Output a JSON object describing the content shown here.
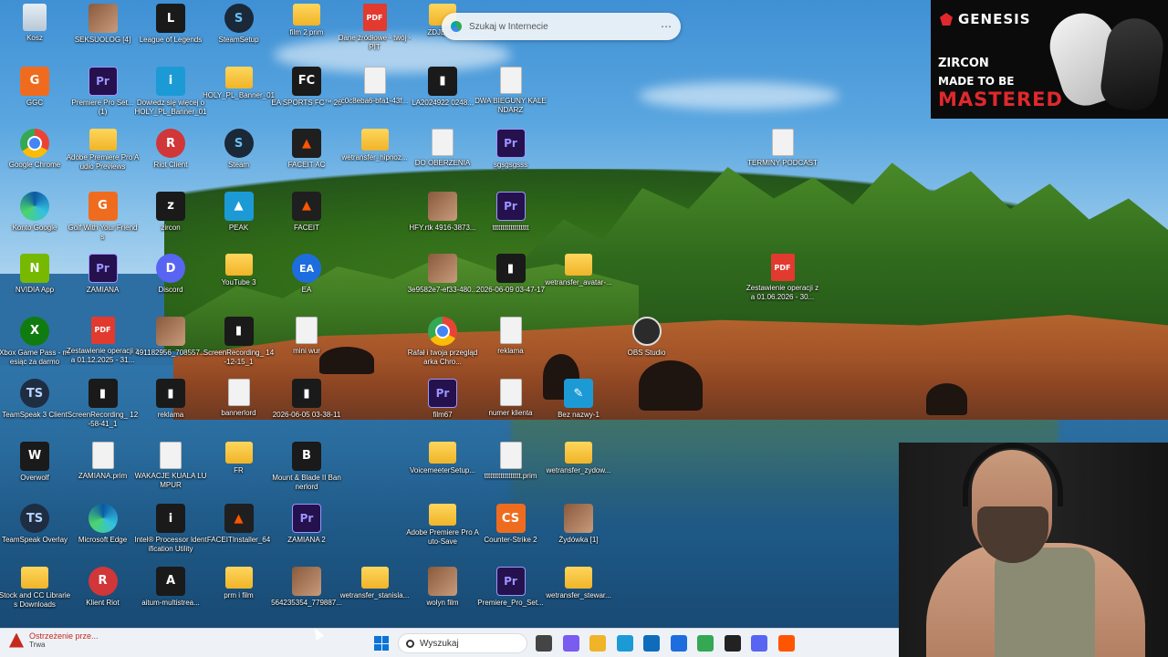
{
  "desktop": {
    "icons": [
      {
        "label": "Kosz",
        "type": "ic-recycle",
        "glyph": "",
        "col": 0,
        "row": 0
      },
      {
        "label": "SEKSUOLOG [4]",
        "type": "ic-thumb",
        "glyph": "",
        "col": 1,
        "row": 0
      },
      {
        "label": "League of Legends",
        "type": "ic-dark",
        "glyph": "L",
        "col": 2,
        "row": 0
      },
      {
        "label": "SteamSetup",
        "type": "ic-steam",
        "glyph": "S",
        "col": 3,
        "row": 0
      },
      {
        "label": "film 2 prim",
        "type": "ic-folder",
        "glyph": "",
        "col": 4,
        "row": 0
      },
      {
        "label": "Dane źródłowe - twój - PIT",
        "type": "ic-pdf",
        "glyph": "PDF",
        "col": 5,
        "row": 0
      },
      {
        "label": "ZDJĘCIA",
        "type": "ic-folder",
        "glyph": "",
        "col": 6,
        "row": 0
      },
      {
        "label": "GGC",
        "type": "ic-orange",
        "glyph": "G",
        "col": 0,
        "row": 1
      },
      {
        "label": "Premiere Pro Set... (1)",
        "type": "ic-pr",
        "glyph": "Pr",
        "col": 1,
        "row": 1
      },
      {
        "label": "Dowiedz się więcej o HOLY_PL_Banner_01 tym zdjęciu",
        "type": "ic-blue",
        "glyph": "i",
        "col": 2,
        "row": 1
      },
      {
        "label": "HOLY_PL_Banner_01",
        "type": "ic-folder",
        "glyph": "",
        "col": 3,
        "row": 1
      },
      {
        "label": "EA SPORTS FC™ 26",
        "type": "ic-dark",
        "glyph": "FC",
        "col": 4,
        "row": 1
      },
      {
        "label": "c0c8eba6-bfa1-43f...",
        "type": "ic-file",
        "glyph": "",
        "col": 5,
        "row": 1
      },
      {
        "label": "LA2024922 0248...",
        "type": "ic-dark",
        "glyph": "▮",
        "col": 6,
        "row": 1
      },
      {
        "label": "DWA BIEGUNY KALENDARZ",
        "type": "ic-file",
        "glyph": "",
        "col": 7,
        "row": 1
      },
      {
        "label": "Google Chrome",
        "type": "ic-chrome",
        "glyph": "",
        "col": 0,
        "row": 2
      },
      {
        "label": "Adobe Premiere Pro Audio Previews",
        "type": "ic-folder",
        "glyph": "",
        "col": 1,
        "row": 2
      },
      {
        "label": "Riot Client",
        "type": "ic-riot",
        "glyph": "R",
        "col": 2,
        "row": 2
      },
      {
        "label": "Steam",
        "type": "ic-steam",
        "glyph": "S",
        "col": 3,
        "row": 2
      },
      {
        "label": "FACEIT AC",
        "type": "ic-faceit",
        "glyph": "▲",
        "col": 4,
        "row": 2
      },
      {
        "label": "wetransfer_hipnoz...",
        "type": "ic-folder",
        "glyph": "",
        "col": 5,
        "row": 2
      },
      {
        "label": "DO OBERZENIA",
        "type": "ic-file",
        "glyph": "",
        "col": 6,
        "row": 2
      },
      {
        "label": "sgsgsgsss",
        "type": "ic-pr",
        "glyph": "Pr",
        "col": 7,
        "row": 2
      },
      {
        "label": "TERMINY PODCAST",
        "type": "ic-file",
        "glyph": "",
        "col": 11,
        "row": 2
      },
      {
        "label": "Konto Google",
        "type": "ic-edge",
        "glyph": "",
        "col": 0,
        "row": 3
      },
      {
        "label": "Golf With Your Friends",
        "type": "ic-orange",
        "glyph": "G",
        "col": 1,
        "row": 3
      },
      {
        "label": "zircon",
        "type": "ic-dark",
        "glyph": "z",
        "col": 2,
        "row": 3
      },
      {
        "label": "PEAK",
        "type": "ic-blue",
        "glyph": "▲",
        "col": 3,
        "row": 3
      },
      {
        "label": "FACEIT",
        "type": "ic-faceit",
        "glyph": "▲",
        "col": 4,
        "row": 3
      },
      {
        "label": "HFY.rtk 4916-3873...",
        "type": "ic-thumb",
        "glyph": "",
        "col": 6,
        "row": 3
      },
      {
        "label": "tttttttttttttttttt",
        "type": "ic-pr",
        "glyph": "Pr",
        "col": 7,
        "row": 3
      },
      {
        "label": "NVIDIA App",
        "type": "ic-green",
        "glyph": "N",
        "col": 0,
        "row": 4
      },
      {
        "label": "ZAMIANA",
        "type": "ic-pr",
        "glyph": "Pr",
        "col": 1,
        "row": 4
      },
      {
        "label": "Discord",
        "type": "ic-discord",
        "glyph": "D",
        "col": 2,
        "row": 4
      },
      {
        "label": "YouTube 3",
        "type": "ic-folder",
        "glyph": "",
        "col": 3,
        "row": 4
      },
      {
        "label": "EA",
        "type": "ic-ea",
        "glyph": "EA",
        "col": 4,
        "row": 4
      },
      {
        "label": "3e9582e7-ef33-480...",
        "type": "ic-thumb",
        "glyph": "",
        "col": 6,
        "row": 4
      },
      {
        "label": "2026-06-09 03-47-17",
        "type": "ic-dark",
        "glyph": "▮",
        "col": 7,
        "row": 4
      },
      {
        "label": "wetransfer_avatar-...",
        "type": "ic-folder",
        "glyph": "",
        "col": 8,
        "row": 4
      },
      {
        "label": "Zestawienie operacji za 01.06.2026 - 30...",
        "type": "ic-pdf",
        "glyph": "PDF",
        "col": 11,
        "row": 4
      },
      {
        "label": "Xbox Game Pass - miesiąc za darmo",
        "type": "ic-xbox",
        "glyph": "X",
        "col": 0,
        "row": 5
      },
      {
        "label": "Zestawienie operacji za 01.12.2025 - 31...",
        "type": "ic-pdf",
        "glyph": "PDF",
        "col": 1,
        "row": 5
      },
      {
        "label": "491182956_708557...",
        "type": "ic-thumb",
        "glyph": "",
        "col": 2,
        "row": 5
      },
      {
        "label": "ScreenRecording_ 14-12-15_1",
        "type": "ic-dark",
        "glyph": "▮",
        "col": 3,
        "row": 5
      },
      {
        "label": "mini wur",
        "type": "ic-file",
        "glyph": "",
        "col": 4,
        "row": 5
      },
      {
        "label": "Rafał i twoja przeglądarka Chro...",
        "type": "ic-chrome",
        "glyph": "",
        "col": 6,
        "row": 5
      },
      {
        "label": "reklama",
        "type": "ic-file",
        "glyph": "",
        "col": 7,
        "row": 5
      },
      {
        "label": "OBS Studio",
        "type": "ic-obs",
        "glyph": "",
        "col": 9,
        "row": 5
      },
      {
        "label": "TeamSpeak 3 Client",
        "type": "ic-ts",
        "glyph": "TS",
        "col": 0,
        "row": 6
      },
      {
        "label": "ScreenRecording_ 12-58-41_1",
        "type": "ic-dark",
        "glyph": "▮",
        "col": 1,
        "row": 6
      },
      {
        "label": "reklama",
        "type": "ic-dark",
        "glyph": "▮",
        "col": 2,
        "row": 6
      },
      {
        "label": "bannerlord",
        "type": "ic-file",
        "glyph": "",
        "col": 3,
        "row": 6
      },
      {
        "label": "2026-06-05 03-38-11",
        "type": "ic-dark",
        "glyph": "▮",
        "col": 4,
        "row": 6
      },
      {
        "label": "film67",
        "type": "ic-pr",
        "glyph": "Pr",
        "col": 6,
        "row": 6
      },
      {
        "label": "numer klienta",
        "type": "ic-file",
        "glyph": "",
        "col": 7,
        "row": 6
      },
      {
        "label": "Bez nazwy-1",
        "type": "ic-blue",
        "glyph": "✎",
        "col": 8,
        "row": 6
      },
      {
        "label": "Overwolf",
        "type": "ic-dark",
        "glyph": "W",
        "col": 0,
        "row": 7
      },
      {
        "label": "ZAMIANA.prim",
        "type": "ic-file",
        "glyph": "",
        "col": 1,
        "row": 7
      },
      {
        "label": "WAKACJE KUALA LUMPUR",
        "type": "ic-file",
        "glyph": "",
        "col": 2,
        "row": 7
      },
      {
        "label": "FR",
        "type": "ic-folder",
        "glyph": "",
        "col": 3,
        "row": 7
      },
      {
        "label": "Mount & Blade II Bannerlord",
        "type": "ic-dark",
        "glyph": "B",
        "col": 4,
        "row": 7
      },
      {
        "label": "VoicemeeterSetup...",
        "type": "ic-folder",
        "glyph": "",
        "col": 6,
        "row": 7
      },
      {
        "label": "tttttttttttttttttt.prim",
        "type": "ic-file",
        "glyph": "",
        "col": 7,
        "row": 7
      },
      {
        "label": "wetransfer_zydow...",
        "type": "ic-folder",
        "glyph": "",
        "col": 8,
        "row": 7
      },
      {
        "label": "TeamSpeak Overlay",
        "type": "ic-ts",
        "glyph": "TS",
        "col": 0,
        "row": 8
      },
      {
        "label": "Microsoft Edge",
        "type": "ic-edge",
        "glyph": "",
        "col": 1,
        "row": 8
      },
      {
        "label": "Intel® Processor Identification Utility",
        "type": "ic-dark",
        "glyph": "i",
        "col": 2,
        "row": 8
      },
      {
        "label": "FACEITInstaller_64",
        "type": "ic-faceit",
        "glyph": "▲",
        "col": 3,
        "row": 8
      },
      {
        "label": "ZAMIANA 2",
        "type": "ic-pr",
        "glyph": "Pr",
        "col": 4,
        "row": 8
      },
      {
        "label": "Adobe Premiere Pro Auto-Save",
        "type": "ic-folder",
        "glyph": "",
        "col": 6,
        "row": 8
      },
      {
        "label": "Counter-Strike 2",
        "type": "ic-orange",
        "glyph": "CS",
        "col": 7,
        "row": 8
      },
      {
        "label": "Żydówka [1]",
        "type": "ic-thumb",
        "glyph": "",
        "col": 8,
        "row": 8
      },
      {
        "label": "Stock and CC Libraries Downloads",
        "type": "ic-folder",
        "glyph": "",
        "col": 0,
        "row": 9
      },
      {
        "label": "Klient Riot",
        "type": "ic-riot",
        "glyph": "R",
        "col": 1,
        "row": 9
      },
      {
        "label": "aitum-multistrea...",
        "type": "ic-dark",
        "glyph": "A",
        "col": 2,
        "row": 9
      },
      {
        "label": "prm i film",
        "type": "ic-folder",
        "glyph": "",
        "col": 3,
        "row": 9
      },
      {
        "label": "564235354_779887...",
        "type": "ic-thumb",
        "glyph": "",
        "col": 4,
        "row": 9
      },
      {
        "label": "wetransfer_stanisla...",
        "type": "ic-folder",
        "glyph": "",
        "col": 5,
        "row": 9
      },
      {
        "label": "wolyn film",
        "type": "ic-thumb",
        "glyph": "",
        "col": 6,
        "row": 9
      },
      {
        "label": "Premiere_Pro_Set...",
        "type": "ic-pr",
        "glyph": "Pr",
        "col": 7,
        "row": 9
      },
      {
        "label": "wetransfer_stewar...",
        "type": "ic-folder",
        "glyph": "",
        "col": 8,
        "row": 9
      }
    ]
  },
  "search_popup": {
    "placeholder": "Szukaj w Internecie",
    "more_glyph": "⋯"
  },
  "ad": {
    "brand": "GENESIS",
    "product": "ZIRCON",
    "tagline_top": "MADE TO BE",
    "tagline_bottom": "MASTERED"
  },
  "taskbar": {
    "notification_title": "Ostrzeżenie prze...",
    "notification_status": "Trwa",
    "search_label": "Wyszukaj",
    "apps": [
      {
        "name": "task-view-icon",
        "color": "#444444"
      },
      {
        "name": "copilot-icon",
        "color": "#7a5cf0"
      },
      {
        "name": "file-explorer-icon",
        "color": "#f0b429"
      },
      {
        "name": "edge-icon",
        "color": "#1c9ad6"
      },
      {
        "name": "outlook-icon",
        "color": "#0f6cbd"
      },
      {
        "name": "store-icon",
        "color": "#1e6ddf"
      },
      {
        "name": "chrome-icon",
        "color": "#34a853"
      },
      {
        "name": "riot-client-icon",
        "color": "#222222"
      },
      {
        "name": "discord-icon",
        "color": "#5865f2"
      },
      {
        "name": "faceit-icon",
        "color": "#ff5500"
      }
    ]
  },
  "colors": {
    "accent": "#0b74d8",
    "warning": "#c42b1c",
    "ad_red": "#e0282d"
  }
}
